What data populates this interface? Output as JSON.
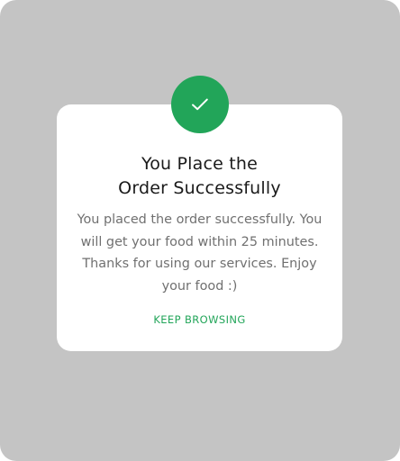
{
  "dialog": {
    "icon": "checkmark-icon",
    "title_line1": "You Place the",
    "title_line2": "Order Successfully",
    "message": "You placed the order successfully. You will get your food within 25 minutes. Thanks for using our services. Enjoy your food :)",
    "action_label": "KEEP BROWSING"
  },
  "colors": {
    "accent": "#22a559",
    "overlay": "#c4c4c4",
    "card": "#ffffff",
    "title_text": "#1a1a1a",
    "body_text": "#707070"
  }
}
